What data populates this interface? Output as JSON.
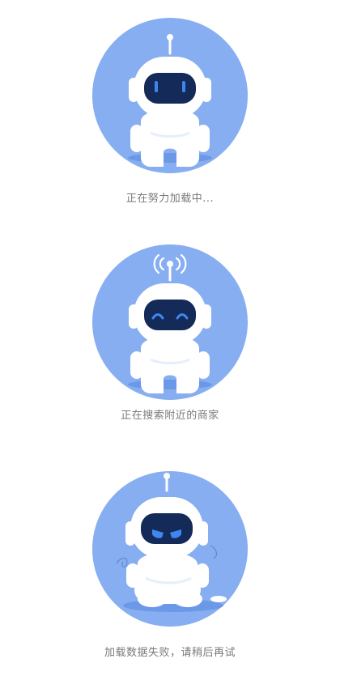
{
  "colors": {
    "background": "#ffffff",
    "circle": "#86aef1",
    "robot_body": "#ffffff",
    "visor": "#142a58",
    "eye": "#3f86f0",
    "shadow": "#6c98e8",
    "caption_text": "#7a7a7a"
  },
  "states": [
    {
      "id": "loading",
      "caption": "正在努力加载中...",
      "robot_expression": "neutral-eyes",
      "antenna": "plain"
    },
    {
      "id": "searching",
      "caption": "正在搜索附近的商家",
      "robot_expression": "smiling-eyes",
      "antenna": "signal-waves"
    },
    {
      "id": "failed",
      "caption": "加载数据失败，请稍后再试",
      "robot_expression": "sad-eyes",
      "antenna": "plain",
      "pose": "sitting-fallen"
    }
  ]
}
